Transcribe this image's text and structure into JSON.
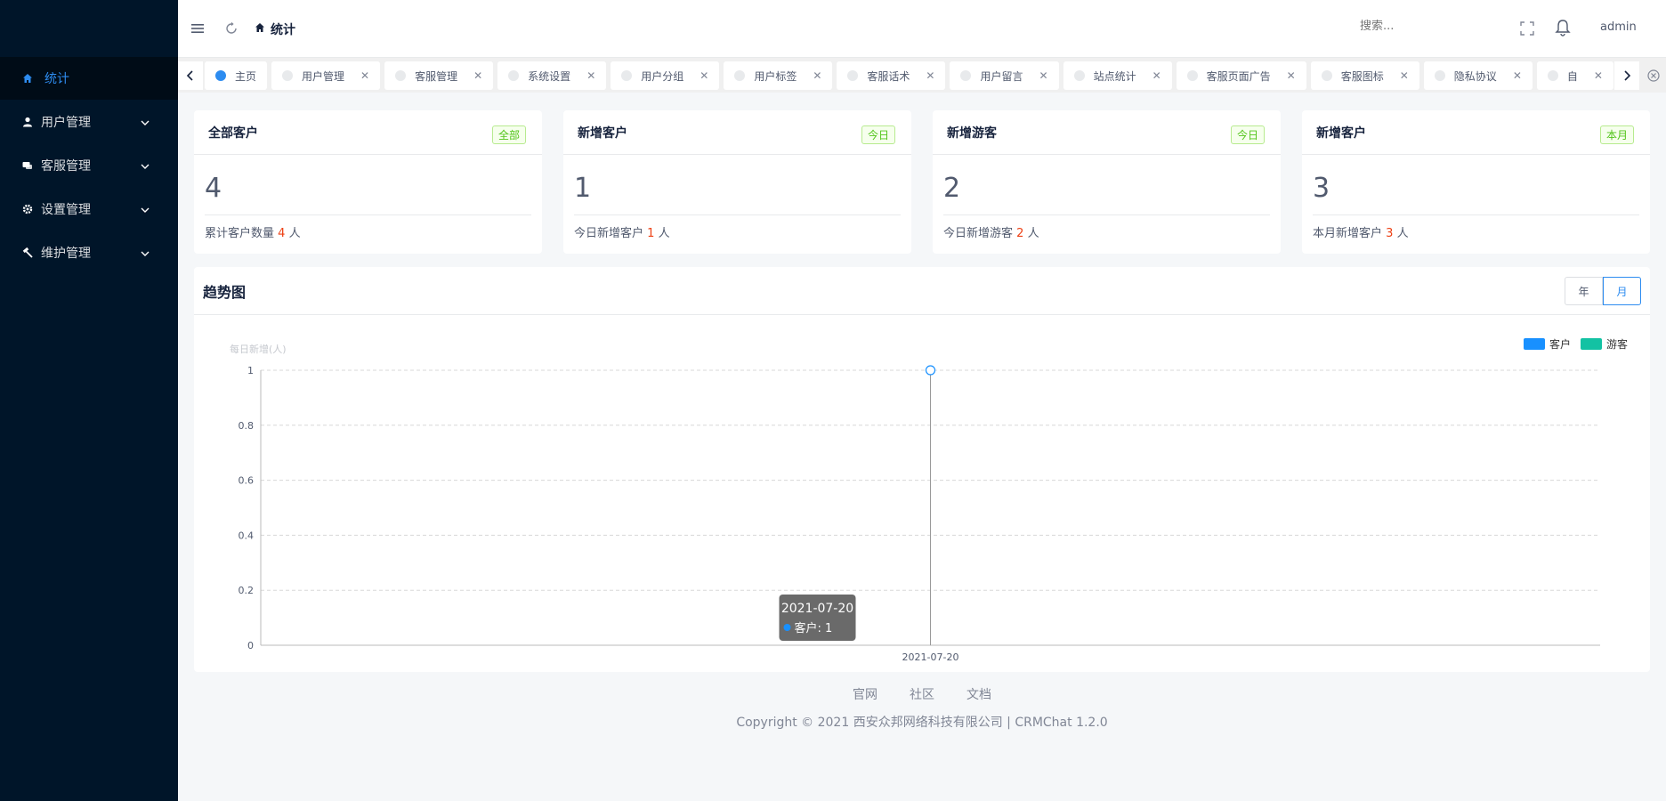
{
  "sidebar": {
    "items": [
      {
        "label": "统计",
        "icon": "home-icon"
      },
      {
        "label": "用户管理",
        "icon": "user-icon"
      },
      {
        "label": "客服管理",
        "icon": "chat-icon"
      },
      {
        "label": "设置管理",
        "icon": "gear-icon"
      },
      {
        "label": "维护管理",
        "icon": "hammer-icon"
      }
    ]
  },
  "header": {
    "breadcrumb": "统计",
    "search_placeholder": "搜索...",
    "user": "admin"
  },
  "tabs": [
    {
      "label": "主页"
    },
    {
      "label": "用户管理"
    },
    {
      "label": "客服管理"
    },
    {
      "label": "系统设置"
    },
    {
      "label": "用户分组"
    },
    {
      "label": "用户标签"
    },
    {
      "label": "客服话术"
    },
    {
      "label": "用户留言"
    },
    {
      "label": "站点统计"
    },
    {
      "label": "客服页面广告"
    },
    {
      "label": "客服图标"
    },
    {
      "label": "隐私协议"
    },
    {
      "label": "自"
    }
  ],
  "cards": [
    {
      "title": "全部客户",
      "tag": "全部",
      "value": "4",
      "foot_pre": "累计客户数量",
      "foot_num": "4",
      "foot_unit": "人"
    },
    {
      "title": "新增客户",
      "tag": "今日",
      "value": "1",
      "foot_pre": "今日新增客户",
      "foot_num": "1",
      "foot_unit": "人"
    },
    {
      "title": "新增游客",
      "tag": "今日",
      "value": "2",
      "foot_pre": "今日新增游客",
      "foot_num": "2",
      "foot_unit": "人"
    },
    {
      "title": "新增客户",
      "tag": "本月",
      "value": "3",
      "foot_pre": "本月新增客户",
      "foot_num": "3",
      "foot_unit": "人"
    }
  ],
  "trend": {
    "title": "趋势图",
    "period_year": "年",
    "period_month": "月",
    "tooltip_date": "2021-07-20",
    "tooltip_value": "客户: 1"
  },
  "chart_data": {
    "type": "line",
    "x": [
      "2021-07-20"
    ],
    "series": [
      {
        "name": "客户",
        "values": [
          1
        ],
        "color": "#1890ff"
      },
      {
        "name": "游客",
        "values": [
          0
        ],
        "color": "#13c2a3"
      }
    ],
    "ylabel": "每日新增(人)",
    "ylim": [
      0,
      1
    ],
    "yticks": [
      "0",
      "0.2",
      "0.4",
      "0.6",
      "0.8",
      "1"
    ],
    "grid": true,
    "legend": "top-right"
  },
  "footer": {
    "links": [
      "官网",
      "社区",
      "文档"
    ],
    "copyright": "Copyright © 2021 西安众邦网络科技有限公司 | CRMChat 1.2.0"
  }
}
